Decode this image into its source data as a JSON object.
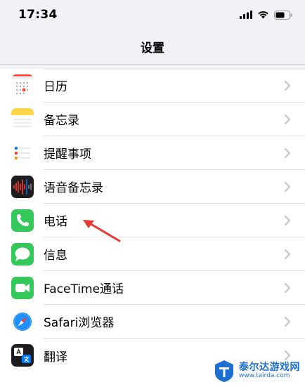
{
  "status_bar": {
    "time": "17:34"
  },
  "nav": {
    "title": "设置"
  },
  "settings": [
    {
      "label": "日历",
      "icon": "calendar-icon"
    },
    {
      "label": "备忘录",
      "icon": "notes-icon"
    },
    {
      "label": "提醒事项",
      "icon": "reminders-icon"
    },
    {
      "label": "语音备忘录",
      "icon": "voice-memos-icon"
    },
    {
      "label": "电话",
      "icon": "phone-icon"
    },
    {
      "label": "信息",
      "icon": "messages-icon"
    },
    {
      "label": "FaceTime通话",
      "icon": "facetime-icon"
    },
    {
      "label": "Safari浏览器",
      "icon": "safari-icon"
    },
    {
      "label": "翻译",
      "icon": "translate-icon"
    }
  ],
  "watermark": {
    "title": "泰尔达游戏网",
    "url": "www.tairda.com"
  },
  "colors": {
    "phone_green": "#34c759",
    "arrow_red": "#e53935",
    "accent_blue": "#007aff"
  }
}
